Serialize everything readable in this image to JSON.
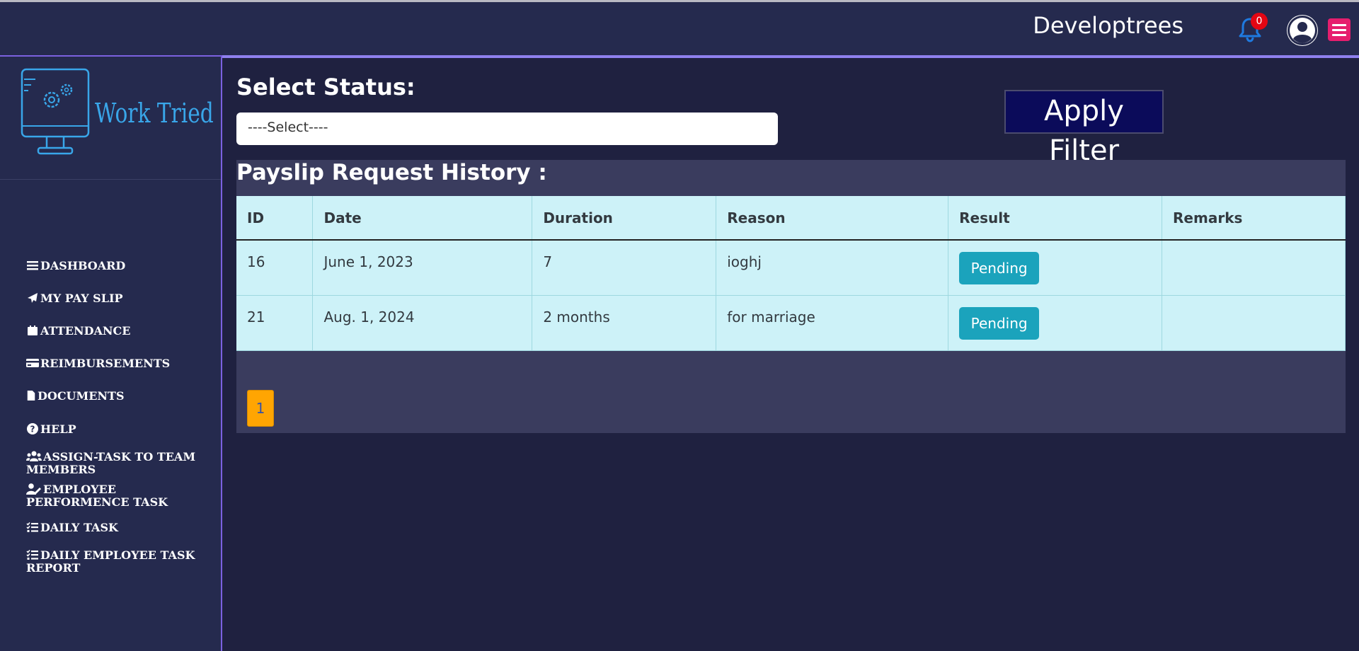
{
  "header": {
    "brand": "Developtrees",
    "notification_count": "0",
    "icons": [
      "bell-icon",
      "user-avatar-icon",
      "hamburger-menu-icon"
    ],
    "colors": {
      "bg": "#252a4e",
      "badge": "#e30613",
      "menu": "#e61e6e",
      "bell": "#1f7ae0"
    }
  },
  "sidebar": {
    "logo_text": "Work Tried",
    "items": [
      {
        "label": "DASHBOARD",
        "icon": "bars-icon"
      },
      {
        "label": "MY PAY SLIP",
        "icon": "paper-plane-icon"
      },
      {
        "label": "ATTENDANCE",
        "icon": "calendar-icon"
      },
      {
        "label": "REIMBURSEMENTS",
        "icon": "credit-card-icon"
      },
      {
        "label": "DOCUMENTS",
        "icon": "file-icon"
      },
      {
        "label": "HELP",
        "icon": "question-circle-icon"
      },
      {
        "label": "ASSIGN-TASK TO TEAM MEMBERS",
        "icon": "users-icon"
      },
      {
        "label": "EMPLOYEE PERFORMENCE TASK",
        "icon": "user-edit-icon"
      },
      {
        "label": "DAILY TASK",
        "icon": "list-check-icon"
      },
      {
        "label": "DAILY EMPLOYEE TASK REPORT",
        "icon": "list-check-icon"
      }
    ]
  },
  "filter": {
    "label": "Select Status:",
    "select_value": "----Select----",
    "apply_label": "Apply Filter"
  },
  "history": {
    "title": "Payslip Request History :",
    "columns": [
      "ID",
      "Date",
      "Duration",
      "Reason",
      "Result",
      "Remarks"
    ],
    "rows": [
      {
        "id": "16",
        "date": "June 1, 2023",
        "duration": "7",
        "reason": "ioghj",
        "result": "Pending",
        "remarks": ""
      },
      {
        "id": "21",
        "date": "Aug. 1, 2024",
        "duration": "2 months",
        "reason": "for marriage",
        "result": "Pending",
        "remarks": ""
      }
    ],
    "page": "1"
  }
}
